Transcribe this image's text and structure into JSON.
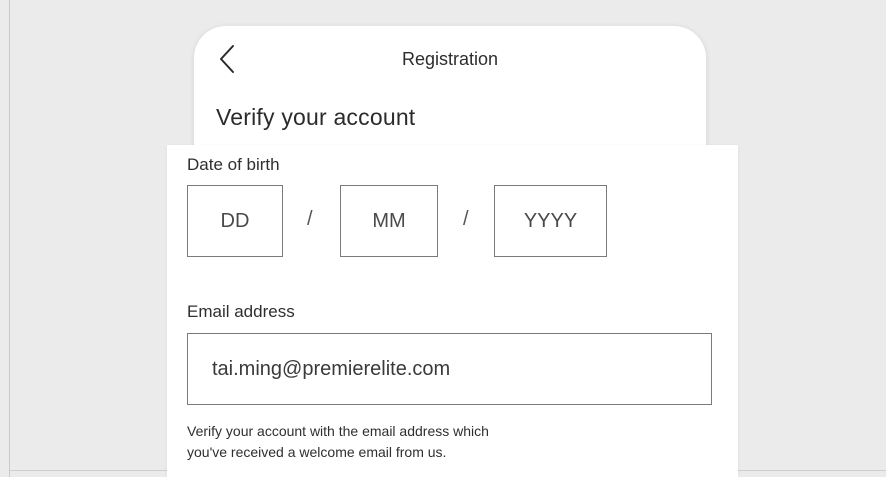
{
  "header": {
    "title": "Registration",
    "back_icon": "chevron-left-icon"
  },
  "main": {
    "heading": "Verify your account",
    "dob": {
      "label": "Date of birth",
      "day_placeholder": "DD",
      "month_placeholder": "MM",
      "year_placeholder": "YYYY",
      "separator": "/"
    },
    "email": {
      "label": "Email address",
      "value": "tai.ming@premierelite.com"
    },
    "helper": {
      "line1": "Verify your account with the email address which",
      "line2": "you've received a welcome email from us."
    }
  },
  "colors": {
    "background": "#ebebeb",
    "surface": "#ffffff",
    "border": "#7a7a7a",
    "text": "#2b2b2b"
  }
}
